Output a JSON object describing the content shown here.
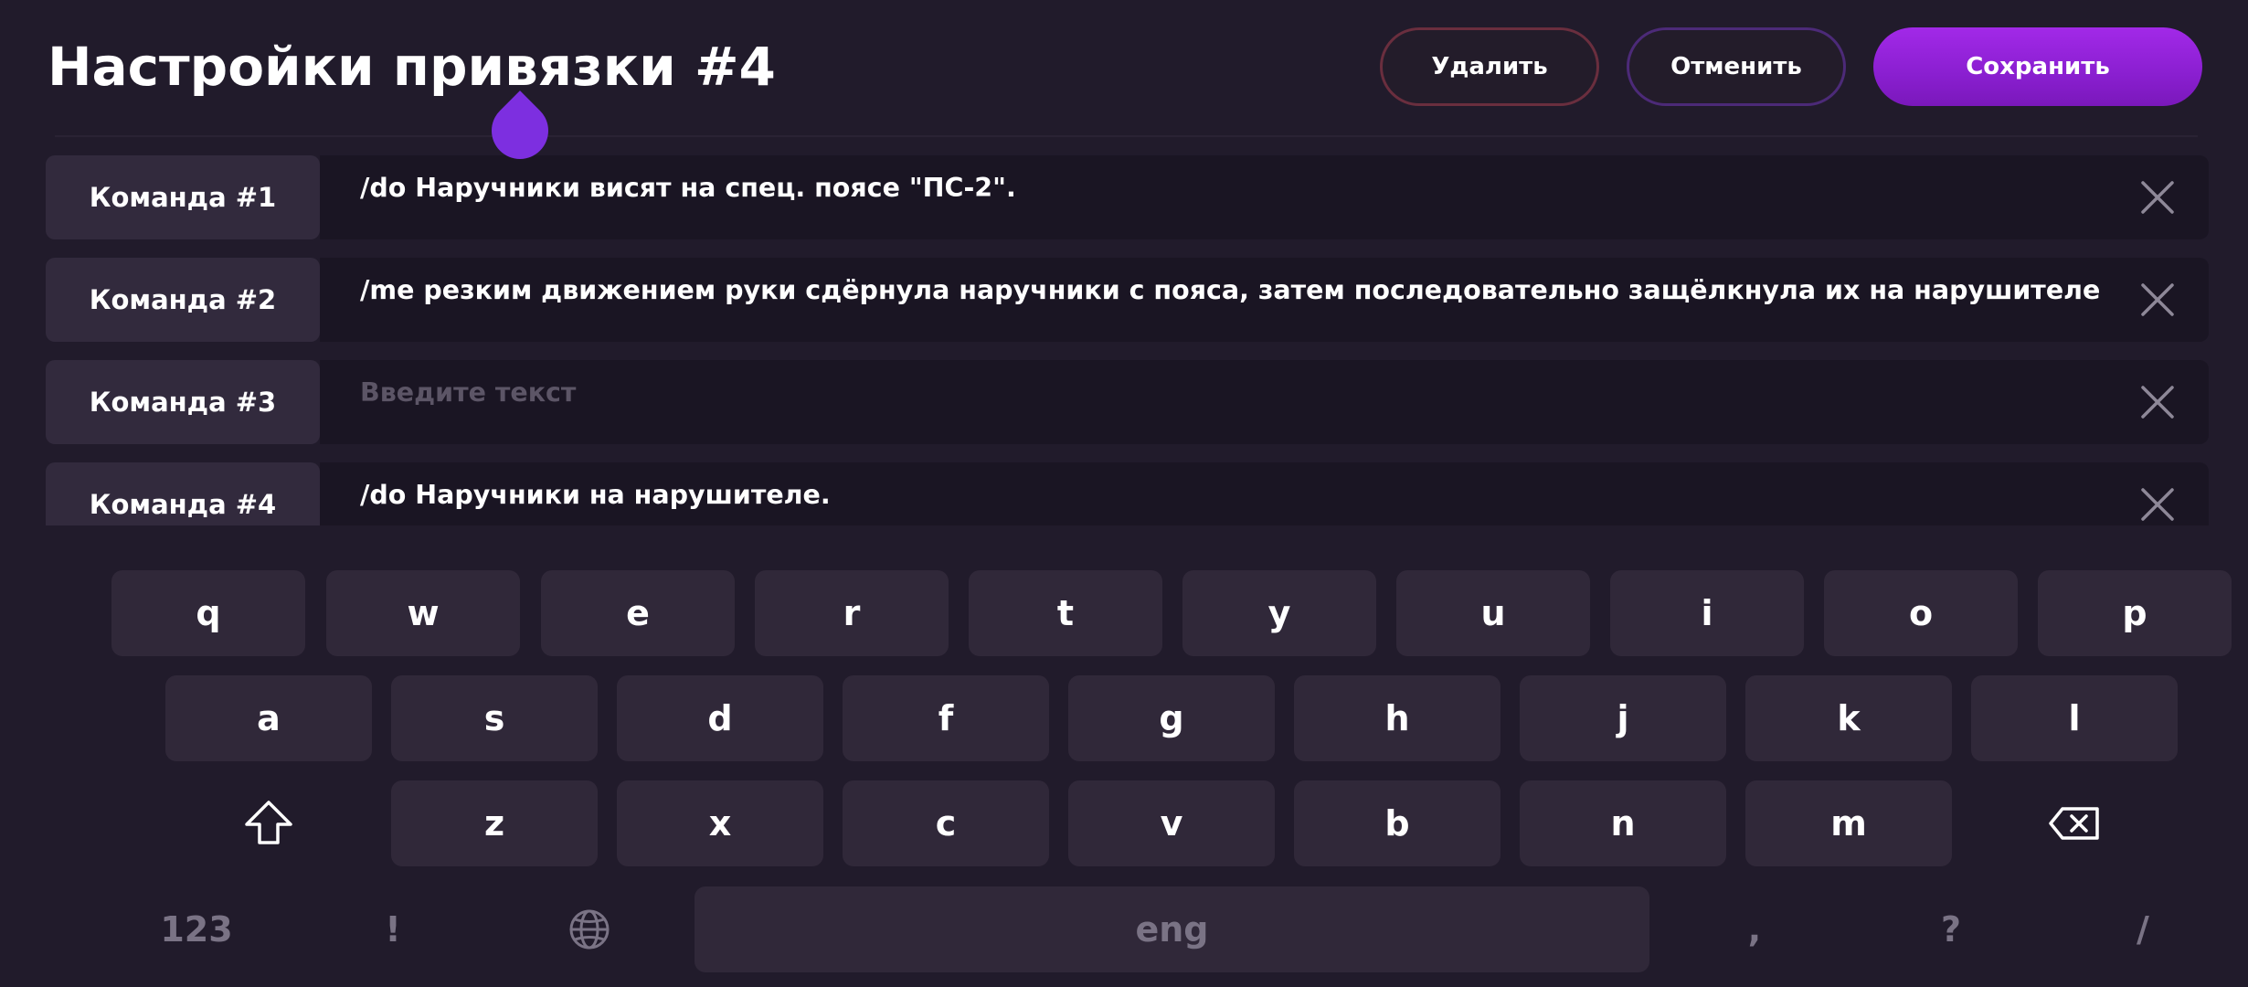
{
  "header": {
    "title": "Настройки привязки #4",
    "delete_label": "Удалить",
    "cancel_label": "Отменить",
    "save_label": "Сохранить"
  },
  "commands": [
    {
      "label": "Команда #1",
      "value": "/do Наручники висят на спец. поясе \"ПС-2\".",
      "placeholder": ""
    },
    {
      "label": "Команда #2",
      "value": "/me резким движением руки сдёрнула наручники с пояса, затем последовательно защёлкнула их на нарушителе",
      "placeholder": ""
    },
    {
      "label": "Команда #3",
      "value": "",
      "placeholder": "Введите текст"
    },
    {
      "label": "Команда #4",
      "value": "/do Наручники на нарушителе.",
      "placeholder": ""
    }
  ],
  "keyboard": {
    "row1": [
      "q",
      "w",
      "e",
      "r",
      "t",
      "y",
      "u",
      "i",
      "o",
      "p"
    ],
    "row2": [
      "a",
      "s",
      "d",
      "f",
      "g",
      "h",
      "j",
      "k",
      "l"
    ],
    "row3": [
      "z",
      "x",
      "c",
      "v",
      "b",
      "n",
      "m"
    ],
    "bottom": {
      "numbers_label": "123",
      "exclaim_label": "!",
      "space_label": "eng",
      "comma_label": ",",
      "question_label": "?",
      "slash_label": "/"
    },
    "icons": {
      "shift": "shift-icon",
      "backspace": "backspace-icon",
      "language": "globe-icon"
    }
  },
  "colors": {
    "background": "#211b2b",
    "accent": "#8a1fd0",
    "delete_border": "#6a2e3e",
    "cancel_border": "#4c2a78"
  }
}
